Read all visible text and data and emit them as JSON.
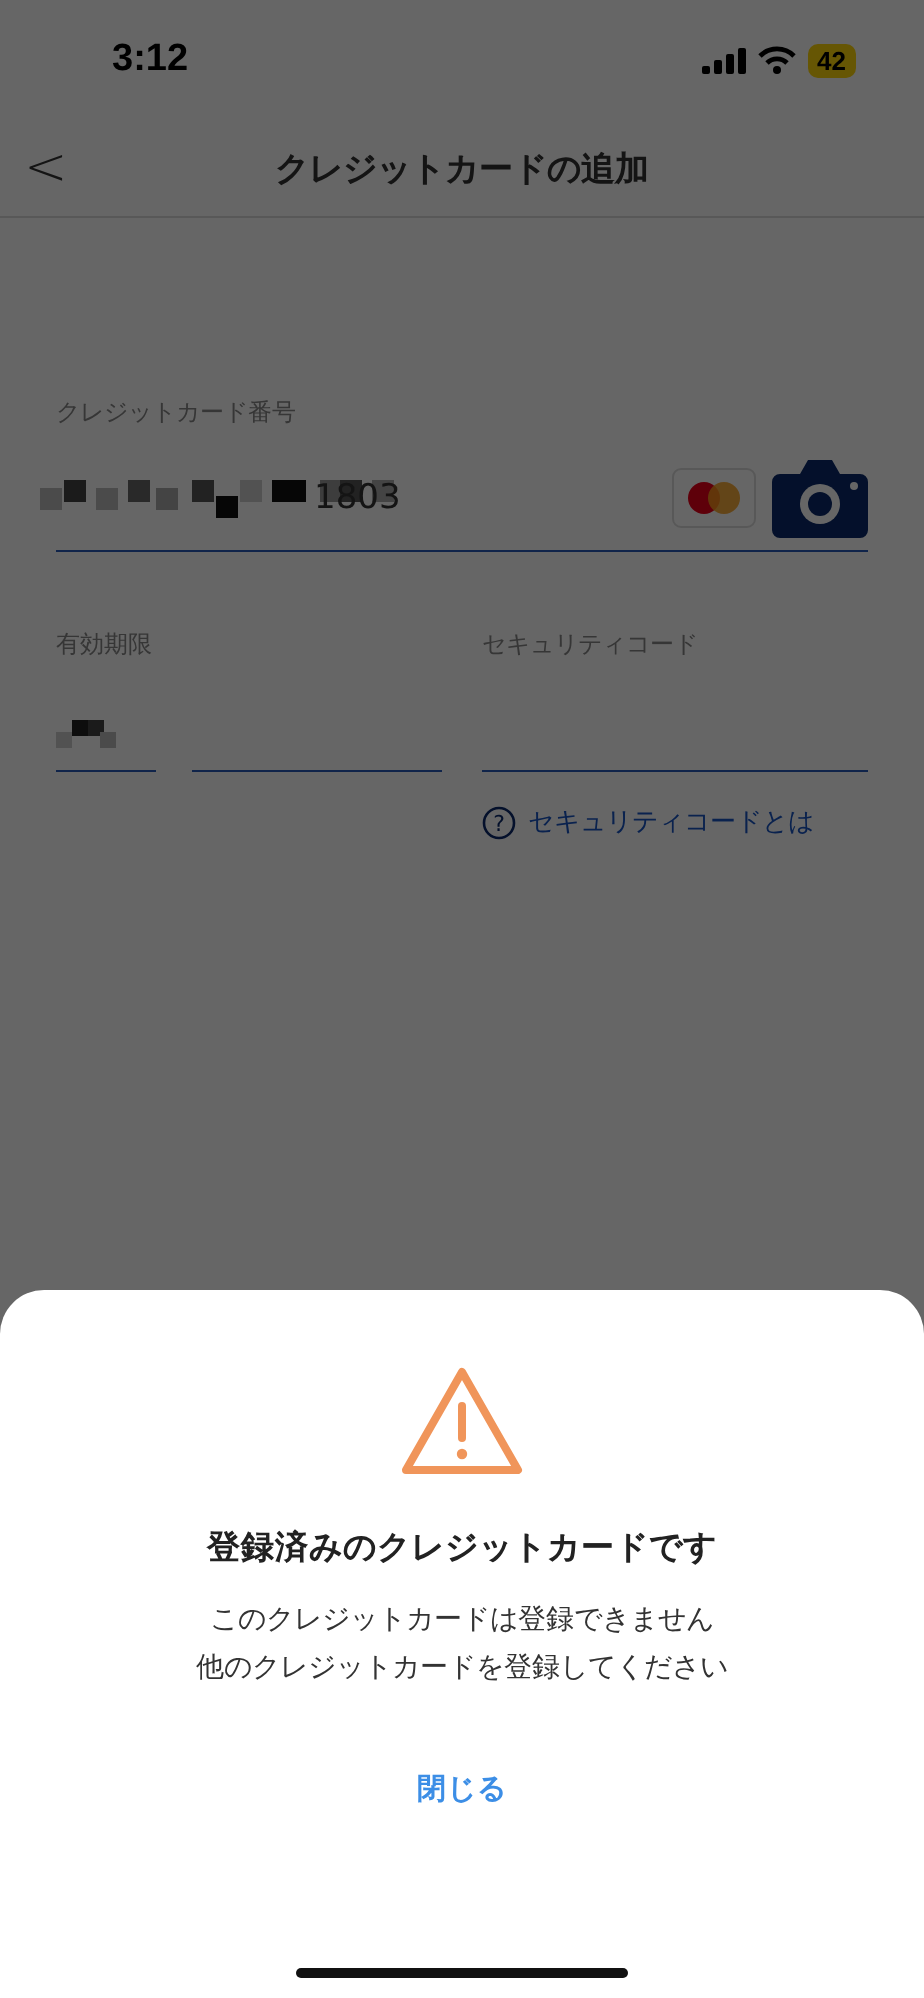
{
  "status_bar": {
    "time": "3:12",
    "battery": "42"
  },
  "header": {
    "back": "<",
    "title": "クレジットカードの追加"
  },
  "form": {
    "card_number": {
      "label": "クレジットカード番号",
      "value": "1803"
    },
    "expiry": {
      "label": "有効期限"
    },
    "security_code": {
      "label": "セキュリティコード",
      "help_icon": "?",
      "help_link": "セキュリティコードとは"
    }
  },
  "dialog": {
    "title": "登録済みのクレジットカードです",
    "message_lines": [
      "このクレジットカードは登録できません",
      "他のクレジットカードを登録してください"
    ],
    "close_button": "閉じる"
  }
}
